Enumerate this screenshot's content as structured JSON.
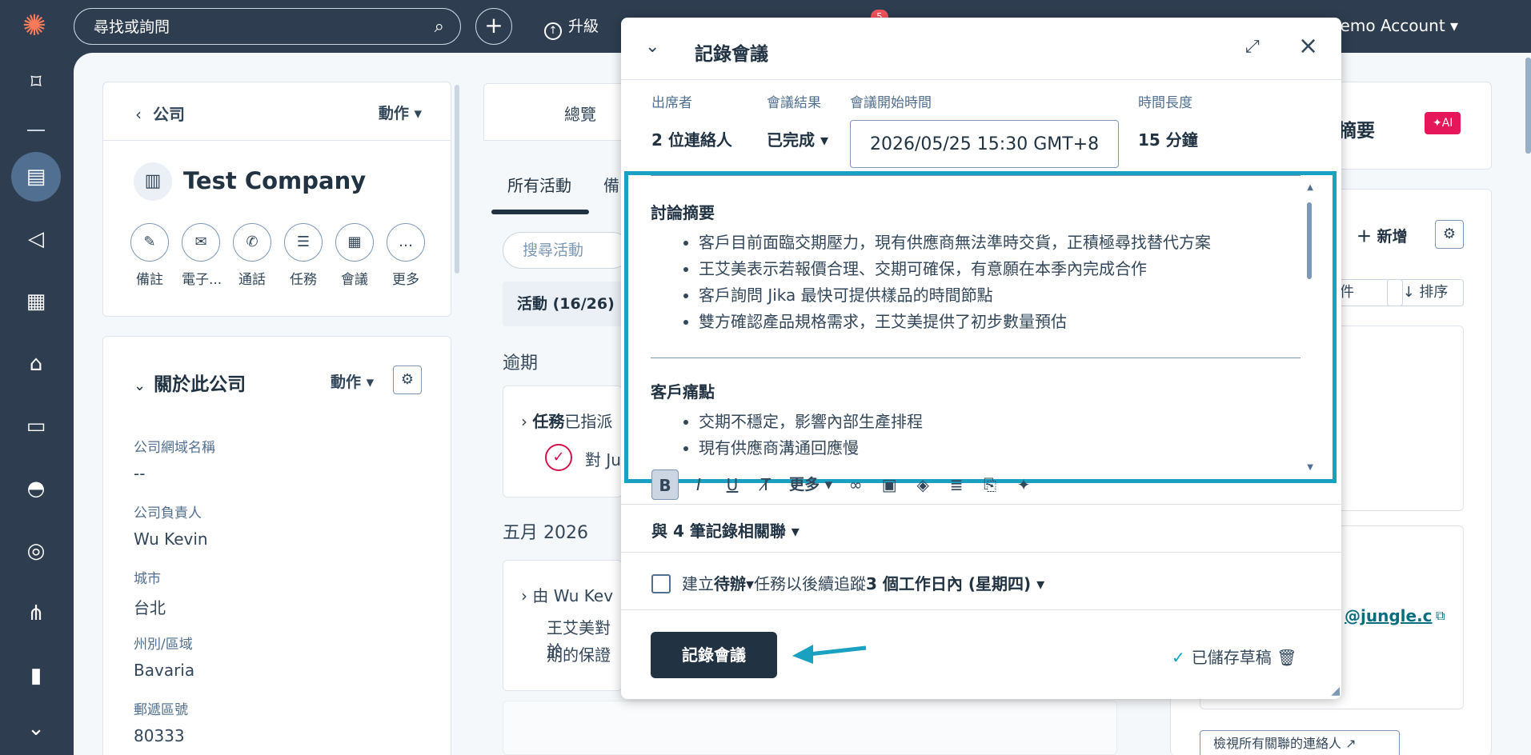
{
  "topbar": {
    "search_placeholder": "尋找或詢問",
    "upgrade_label": "升級",
    "notification_count": "5",
    "account_label": "pot Demo Account"
  },
  "company": {
    "back_label": "公司",
    "actions_label": "動作",
    "name": "Test Company",
    "quick_actions": [
      {
        "label": "備註",
        "icon": "note-icon"
      },
      {
        "label": "電子...",
        "icon": "email-icon"
      },
      {
        "label": "通話",
        "icon": "phone-icon"
      },
      {
        "label": "任務",
        "icon": "task-icon"
      },
      {
        "label": "會議",
        "icon": "calendar-icon"
      },
      {
        "label": "更多",
        "icon": "more-icon"
      }
    ]
  },
  "about": {
    "title": "關於此公司",
    "actions_label": "動作",
    "props": [
      {
        "key": "公司網域名稱",
        "value": "--"
      },
      {
        "key": "公司負責人",
        "value": "Wu Kevin"
      },
      {
        "key": "城市",
        "value": "台北"
      },
      {
        "key": "州別/區域",
        "value": "Bavaria"
      },
      {
        "key": "郵遞區號",
        "value": "80333"
      }
    ]
  },
  "middle": {
    "overview_tab": "總覽",
    "all_activity_tab": "所有活動",
    "second_tab": "備",
    "search_placeholder": "搜尋活動",
    "filter_label": "活動 (16/26)",
    "overdue_label": "逾期",
    "task_prefix": "任務",
    "task_suffix": "已指派",
    "task_sub": "對 Ju",
    "month_label": "五月 2026",
    "note_head": "由 Wu Kev",
    "note_line1": "王艾美對於",
    "note_line2": "期的保證"
  },
  "modal": {
    "title": "記錄會議",
    "attendees_label": "出席者",
    "attendees_value": "2 位連絡人",
    "outcome_label": "會議結果",
    "outcome_value": "已完成",
    "start_label": "會議開始時間",
    "start_value": "2026/05/25 15:30 GMT+8",
    "duration_label": "時間長度",
    "duration_value": "15 分鐘",
    "sections": [
      {
        "heading": "討論摘要",
        "items": [
          "客戶目前面臨交期壓力，現有供應商無法準時交貨，正積極尋找替代方案",
          "王艾美表示若報價合理、交期可確保，有意願在本季內完成合作",
          "客戶詢問 Jika 最快可提供樣品的時間節點",
          "雙方確認產品規格需求，王艾美提供了初步數量預估"
        ]
      },
      {
        "heading": "客戶痛點",
        "items": [
          "交期不穩定，影響內部生產排程",
          "現有供應商溝通回應慢"
        ]
      }
    ],
    "toolbar_more": "更多",
    "associations": "與 4 筆記錄相關聯",
    "todo_prefix": "建立",
    "todo_type": "待辦",
    "todo_middle": "任務以後續追蹤",
    "todo_when": "3 個工作日內 (星期四)",
    "submit_label": "記錄會議",
    "saved_label": "已儲存草稿"
  },
  "right": {
    "summary_title": "摘要",
    "ai_badge": "✦AI",
    "add_label": "新增",
    "filter_label": "件",
    "sort_label": "排序",
    "email_fragment": "@jungle.c",
    "view_all_label": "檢視所有關聯的連絡人"
  },
  "colors": {
    "accent": "#1aa1c2",
    "nav_bg": "#2e3e50",
    "primary_btn": "#213343",
    "ai_badge": "#e5175a"
  }
}
